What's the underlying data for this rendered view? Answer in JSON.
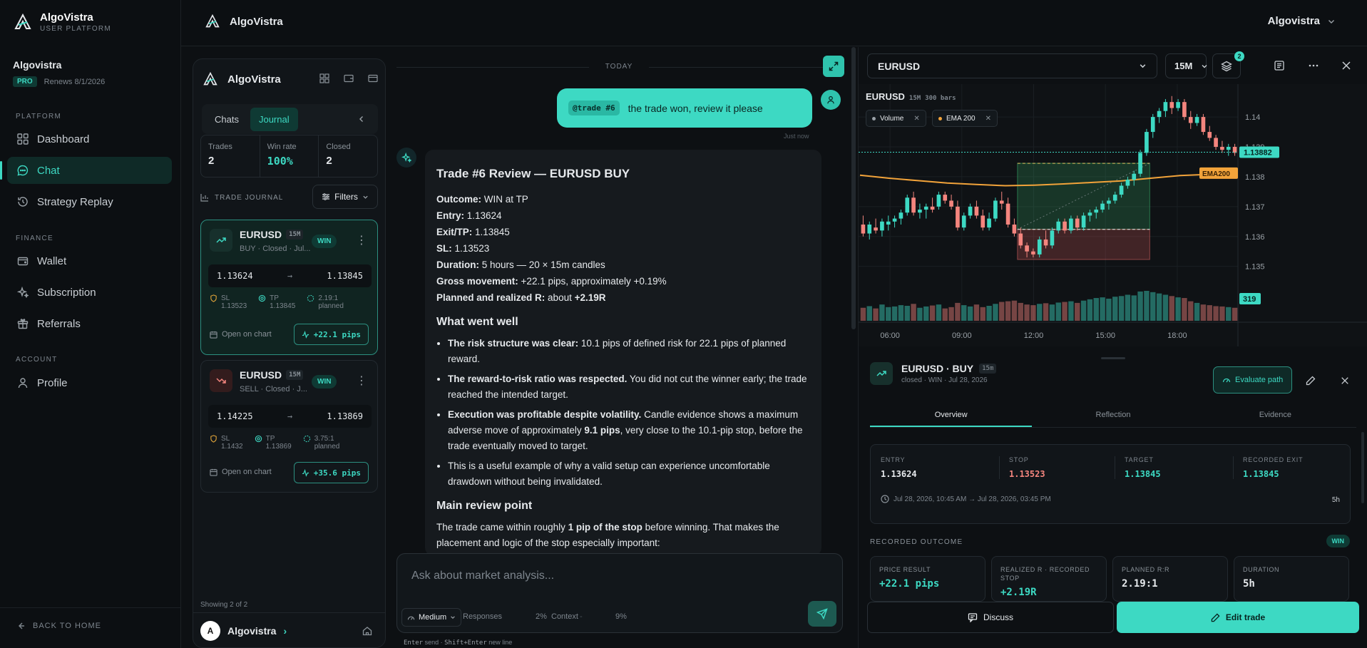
{
  "brand": {
    "name": "AlgoVistra",
    "subtitle": "USER PLATFORM"
  },
  "account": {
    "name": "Algovistra",
    "plan": "PRO",
    "renews": "Renews 8/1/2026"
  },
  "sidebar": {
    "sections": [
      "PLATFORM",
      "FINANCE",
      "ACCOUNT"
    ],
    "items": [
      {
        "label": "Dashboard",
        "icon": "grid-icon"
      },
      {
        "label": "Chat",
        "icon": "chat-icon",
        "active": true
      },
      {
        "label": "Strategy Replay",
        "icon": "replay-icon"
      },
      {
        "label": "Wallet",
        "icon": "wallet-icon"
      },
      {
        "label": "Subscription",
        "icon": "sparkle-icon"
      },
      {
        "label": "Referrals",
        "icon": "gift-icon"
      },
      {
        "label": "Profile",
        "icon": "user-icon"
      }
    ],
    "back": "BACK TO HOME"
  },
  "topbar": {
    "brand": "AlgoVistra",
    "user": "Algovistra"
  },
  "journal": {
    "title": "AlgoVistra",
    "tabs": [
      "Chats",
      "Journal"
    ],
    "stats": [
      {
        "label": "Trades",
        "value": "2"
      },
      {
        "label": "Win rate",
        "value": "100%"
      },
      {
        "label": "Closed",
        "value": "2"
      }
    ],
    "section": "TRADE JOURNAL",
    "filters": "Filters",
    "cards": [
      {
        "symbol": "EURUSD",
        "tf": "15M",
        "sub": "BUY · Closed · Jul...",
        "result": "WIN",
        "entry": "1.13624",
        "exit": "1.13845",
        "sl_label": "SL",
        "sl": "1.13523",
        "tp_label": "TP",
        "tp": "1.13845",
        "rr": "2.19:1",
        "rr_label": "planned",
        "open": "Open on chart",
        "pips": "+22.1 pips"
      },
      {
        "symbol": "EURUSD",
        "tf": "15M",
        "sub": "SELL · Closed · J...",
        "result": "WIN",
        "entry": "1.14225",
        "exit": "1.13869",
        "sl_label": "SL",
        "sl": "1.1432",
        "tp_label": "TP",
        "tp": "1.13869",
        "rr": "3.75:1",
        "rr_label": "planned",
        "open": "Open on chart",
        "pips": "+35.6 pips"
      }
    ],
    "showing": "Showing 2 of 2",
    "user_initial": "A",
    "user": "Algovistra"
  },
  "chat": {
    "today": "TODAY",
    "user_msg": {
      "tag": "@trade #6",
      "text": "the trade won, review it please",
      "time": "Just now"
    },
    "reply": {
      "title": "Trade #6 Review — EURUSD BUY",
      "facts": [
        {
          "k": "Outcome:",
          "v": " WIN at TP"
        },
        {
          "k": "Entry:",
          "v": " 1.13624"
        },
        {
          "k": "Exit/TP:",
          "v": " 1.13845"
        },
        {
          "k": "SL:",
          "v": " 1.13523"
        },
        {
          "k": "Duration:",
          "v": " 5 hours — 20 × 15m candles"
        },
        {
          "k": "Gross movement:",
          "v": " +22.1 pips, approximately +0.19%"
        },
        {
          "k": "Planned and realized R:",
          "v": " about ",
          "v2": "+2.19R"
        }
      ],
      "h_well": "What went well",
      "bullets": [
        {
          "b": "The risk structure was clear:",
          "t": " 10.1 pips of defined risk for 22.1 pips of planned reward."
        },
        {
          "b": "The reward-to-risk ratio was respected.",
          "t": " You did not cut the winner early; the trade reached the intended target."
        },
        {
          "b": "Execution was profitable despite volatility.",
          "t": " Candle evidence shows a maximum adverse move of approximately ",
          "b2": "9.1 pips",
          "t2": ", very close to the 10.1-pip stop, before the trade eventually moved to target."
        },
        {
          "b": "",
          "t": "This is a useful example of why a valid setup can experience uncomfortable drawdown without being invalidated."
        }
      ],
      "h_main": "Main review point",
      "main_pre": "The trade came within roughly ",
      "main_bold": "1 pip of the stop",
      "main_post": " before winning. That makes the placement and logic of the stop especially important:"
    },
    "composer": {
      "placeholder": "Ask about market analysis...",
      "effort": "Medium",
      "responses_label": "Responses",
      "responses_pct": "2%",
      "context_label": "Context",
      "context_pct": "9%",
      "hint_enter": "Enter",
      "hint_send": "send",
      "hint_shift": "Shift+Enter",
      "hint_newline": "new line"
    }
  },
  "chart": {
    "symbol": "EURUSD",
    "timeframe": "15M",
    "layers_count": "2",
    "label_tf": "15M",
    "label_bars": "300 bars",
    "indicators": [
      {
        "name": "Volume",
        "color": "#9aa1a7"
      },
      {
        "name": "EMA 200",
        "color": "#f2a33a"
      }
    ],
    "price_ticks": [
      "1.14",
      "1.139",
      "1.138",
      "1.137",
      "1.136",
      "1.135"
    ],
    "time_ticks": [
      "06:00",
      "09:00",
      "12:00",
      "15:00",
      "18:00"
    ],
    "last_price": "1.13882",
    "ema_label": "EMA200",
    "volume_label": "319",
    "colors": {
      "up": "#3dd9c3",
      "down": "#f4857e",
      "ema": "#f2a33a"
    }
  },
  "chart_data": {
    "type": "candlestick",
    "x_label": "",
    "y_range": [
      1.1343,
      1.1411
    ],
    "entry": 1.13624,
    "stop": 1.13523,
    "target": 1.13845,
    "ema": [
      1.13805,
      1.13795,
      1.13787,
      1.13779,
      1.13774,
      1.1377,
      1.13772,
      1.13776,
      1.13781,
      1.13786,
      1.13795,
      1.13804,
      1.13808,
      1.13812
    ],
    "ohlc": [
      [
        1.1364,
        1.1367,
        1.136,
        1.1361
      ],
      [
        1.1361,
        1.1365,
        1.1359,
        1.1364
      ],
      [
        1.1363,
        1.1366,
        1.1361,
        1.1362
      ],
      [
        1.1362,
        1.1366,
        1.136,
        1.1365
      ],
      [
        1.1364,
        1.1367,
        1.1362,
        1.1365
      ],
      [
        1.1365,
        1.1367,
        1.1363,
        1.1366
      ],
      [
        1.1366,
        1.1369,
        1.1364,
        1.1368
      ],
      [
        1.1368,
        1.1374,
        1.1367,
        1.1373
      ],
      [
        1.1373,
        1.1375,
        1.1367,
        1.1368
      ],
      [
        1.1368,
        1.1371,
        1.1366,
        1.1369
      ],
      [
        1.1369,
        1.1371,
        1.1366,
        1.137
      ],
      [
        1.137,
        1.1373,
        1.1368,
        1.1369
      ],
      [
        1.137,
        1.1375,
        1.1369,
        1.1374
      ],
      [
        1.1374,
        1.1375,
        1.1371,
        1.1372
      ],
      [
        1.1372,
        1.1374,
        1.1369,
        1.137
      ],
      [
        1.137,
        1.1372,
        1.1362,
        1.1363
      ],
      [
        1.1363,
        1.1368,
        1.1362,
        1.1367
      ],
      [
        1.1367,
        1.1371,
        1.1366,
        1.137
      ],
      [
        1.137,
        1.1372,
        1.1366,
        1.1367
      ],
      [
        1.1367,
        1.1369,
        1.1362,
        1.1363
      ],
      [
        1.1363,
        1.1368,
        1.1362,
        1.1366
      ],
      [
        1.1366,
        1.1373,
        1.1365,
        1.1372
      ],
      [
        1.1372,
        1.1375,
        1.1369,
        1.1371
      ],
      [
        1.1371,
        1.1373,
        1.1363,
        1.1364
      ],
      [
        1.1364,
        1.1366,
        1.136,
        1.1361
      ],
      [
        1.1361,
        1.1363,
        1.1356,
        1.1357
      ],
      [
        1.1357,
        1.1358,
        1.1353,
        1.1355
      ],
      [
        1.1355,
        1.1356,
        1.1353,
        1.1354
      ],
      [
        1.1354,
        1.136,
        1.1353,
        1.1359
      ],
      [
        1.1359,
        1.1362,
        1.1356,
        1.1357
      ],
      [
        1.1357,
        1.1363,
        1.1356,
        1.1362
      ],
      [
        1.1362,
        1.1366,
        1.1361,
        1.1365
      ],
      [
        1.1365,
        1.1366,
        1.1361,
        1.1362
      ],
      [
        1.1362,
        1.1367,
        1.1361,
        1.1366
      ],
      [
        1.1366,
        1.1367,
        1.1362,
        1.1363
      ],
      [
        1.1363,
        1.1368,
        1.1362,
        1.1367
      ],
      [
        1.1367,
        1.1369,
        1.1365,
        1.1368
      ],
      [
        1.1368,
        1.137,
        1.1366,
        1.1369
      ],
      [
        1.1369,
        1.1372,
        1.1368,
        1.1371
      ],
      [
        1.1371,
        1.1373,
        1.1369,
        1.1372
      ],
      [
        1.1372,
        1.1375,
        1.1371,
        1.1374
      ],
      [
        1.1374,
        1.1378,
        1.1373,
        1.1377
      ],
      [
        1.1377,
        1.138,
        1.1376,
        1.1379
      ],
      [
        1.1379,
        1.1382,
        1.1377,
        1.1381
      ],
      [
        1.1381,
        1.1389,
        1.138,
        1.1388
      ],
      [
        1.1388,
        1.1396,
        1.1387,
        1.1395
      ],
      [
        1.1395,
        1.1401,
        1.1393,
        1.14
      ],
      [
        1.14,
        1.1403,
        1.1398,
        1.1402
      ],
      [
        1.1402,
        1.1406,
        1.14,
        1.1405
      ],
      [
        1.1405,
        1.1407,
        1.1401,
        1.1403
      ],
      [
        1.1403,
        1.1406,
        1.1402,
        1.1405
      ],
      [
        1.1405,
        1.1406,
        1.1399,
        1.14
      ],
      [
        1.14,
        1.1402,
        1.1396,
        1.1398
      ],
      [
        1.1398,
        1.1401,
        1.1397,
        1.14
      ],
      [
        1.14,
        1.1401,
        1.1394,
        1.1395
      ],
      [
        1.1395,
        1.1397,
        1.1392,
        1.1393
      ],
      [
        1.1393,
        1.1394,
        1.1389,
        1.139
      ],
      [
        1.139,
        1.1392,
        1.1388,
        1.1389
      ],
      [
        1.1389,
        1.1391,
        1.1387,
        1.139
      ],
      [
        1.139,
        1.1391,
        1.1387,
        1.1388
      ]
    ],
    "volume": [
      40,
      45,
      38,
      50,
      42,
      44,
      48,
      46,
      52,
      40,
      44,
      47,
      50,
      38,
      42,
      55,
      48,
      44,
      50,
      42,
      46,
      52,
      58,
      60,
      62,
      55,
      50,
      48,
      52,
      54,
      50,
      56,
      58,
      60,
      55,
      62,
      66,
      70,
      72,
      68,
      74,
      76,
      80,
      78,
      90,
      92,
      88,
      84,
      80,
      76,
      72,
      70,
      60,
      55,
      50,
      48,
      45,
      44,
      42,
      40
    ]
  },
  "details": {
    "title": "EURUSD · BUY",
    "tf": "15m",
    "sub": "closed · WIN · Jul 28, 2026",
    "evaluate": "Evaluate path",
    "tabs": [
      "Overview",
      "Reflection",
      "Evidence"
    ],
    "levels": [
      {
        "label": "ENTRY",
        "value": "1.13624"
      },
      {
        "label": "STOP",
        "value": "1.13523"
      },
      {
        "label": "TARGET",
        "value": "1.13845"
      },
      {
        "label": "RECORDED EXIT",
        "value": "1.13845"
      }
    ],
    "time_range": "Jul 28, 2026, 10:45 AM → Jul 28, 2026, 03:45 PM",
    "duration_short": "5h",
    "outcome_title": "RECORDED OUTCOME",
    "outcome_badge": "WIN",
    "outcomes": [
      {
        "label": "PRICE RESULT",
        "value": "+22.1 pips"
      },
      {
        "label": "REALIZED R · RECORDED STOP",
        "value": "+2.19R"
      },
      {
        "label": "PLANNED R:R",
        "value": "2.19:1"
      },
      {
        "label": "DURATION",
        "value": "5h"
      }
    ],
    "discuss": "Discuss",
    "edit": "Edit trade"
  }
}
